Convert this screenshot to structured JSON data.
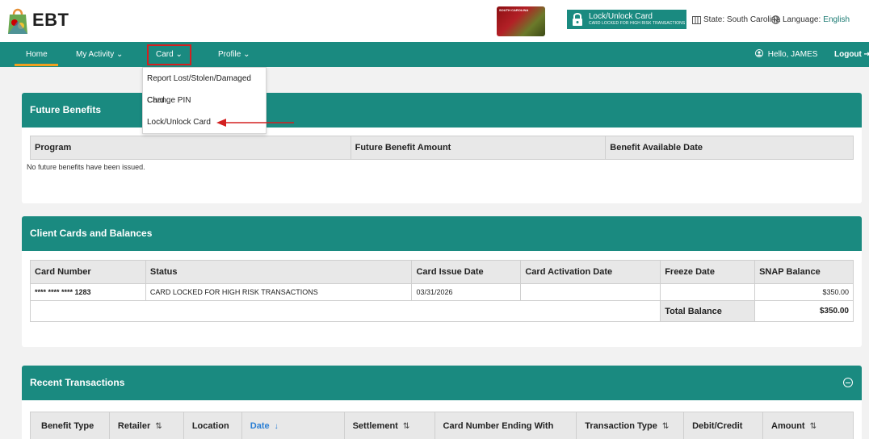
{
  "header": {
    "logo_text": "EBT",
    "card_image_caption": "SOUTH CAROLINA",
    "lock_button": {
      "title": "Lock/Unlock Card",
      "subtitle": "CARD LOCKED FOR HIGH RISK TRANSACTIONS"
    },
    "state_label": "State: South Carolina",
    "language_label": "Language:",
    "language_value": "English"
  },
  "nav": {
    "home": "Home",
    "my_activity": "My Activity",
    "card": "Card",
    "profile": "Profile",
    "greeting": "Hello, JAMES",
    "logout": "Logout"
  },
  "card_menu": {
    "items": [
      "Report Lost/Stolen/Damaged Card",
      "Change PIN",
      "Lock/Unlock Card"
    ]
  },
  "future_benefits": {
    "title": "Future Benefits",
    "columns": [
      "Program",
      "Future Benefit Amount",
      "Benefit Available Date"
    ],
    "empty_message": "No future benefits have been issued."
  },
  "client_cards": {
    "title": "Client Cards and Balances",
    "columns": [
      "Card Number",
      "Status",
      "Card Issue Date",
      "Card Activation Date",
      "Freeze Date",
      "SNAP Balance"
    ],
    "rows": [
      {
        "card_number": "**** **** **** 1283",
        "status": "CARD LOCKED FOR HIGH RISK TRANSACTIONS",
        "issue_date": "03/31/2026",
        "activation_date": "",
        "freeze_date": "",
        "snap_balance": "$350.00"
      }
    ],
    "total_label": "Total Balance",
    "total_value": "$350.00"
  },
  "recent_transactions": {
    "title": "Recent Transactions",
    "columns": [
      "Benefit Type",
      "Retailer",
      "Location",
      "Date",
      "Settlement",
      "Card Number Ending With",
      "Transaction Type",
      "Debit/Credit",
      "Amount"
    ]
  },
  "colors": {
    "teal": "#1a8a80",
    "accent_orange": "#f0a020",
    "highlight_red": "#d32020"
  }
}
